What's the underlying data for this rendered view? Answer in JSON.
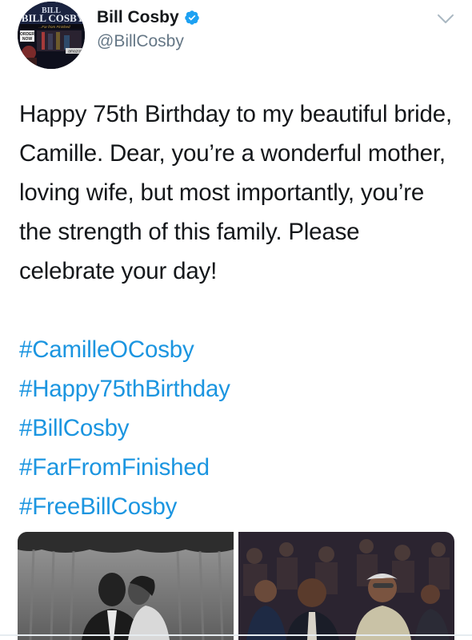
{
  "author": {
    "display_name": "Bill Cosby",
    "handle": "@BillCosby",
    "verified": true,
    "avatar": {
      "brand": "BILL COSBY",
      "tagline": "...Far from Finished",
      "badge": "ORDER NOW",
      "store": "amazon"
    }
  },
  "tweet": {
    "text": "Happy 75th Birthday to my beautiful bride, Camille.  Dear, you’re a wonderful mother, loving wife, but most importantly, you’re the strength of this family. Please celebrate your day!",
    "hashtags": [
      "#CamilleOCosby",
      "#Happy75thBirthday",
      "#BillCosby",
      "#FarFromFinished",
      "#FreeBillCosby"
    ]
  },
  "colors": {
    "link": "#1b95e0",
    "verified": "#1da1f2",
    "handle": "#657786",
    "text": "#14171a"
  },
  "media": [
    {
      "kind": "photo",
      "style": "black-and-white",
      "subject": "couple-wedding-kiss"
    },
    {
      "kind": "photo",
      "style": "color",
      "subject": "couple-seated-in-crowd"
    }
  ]
}
